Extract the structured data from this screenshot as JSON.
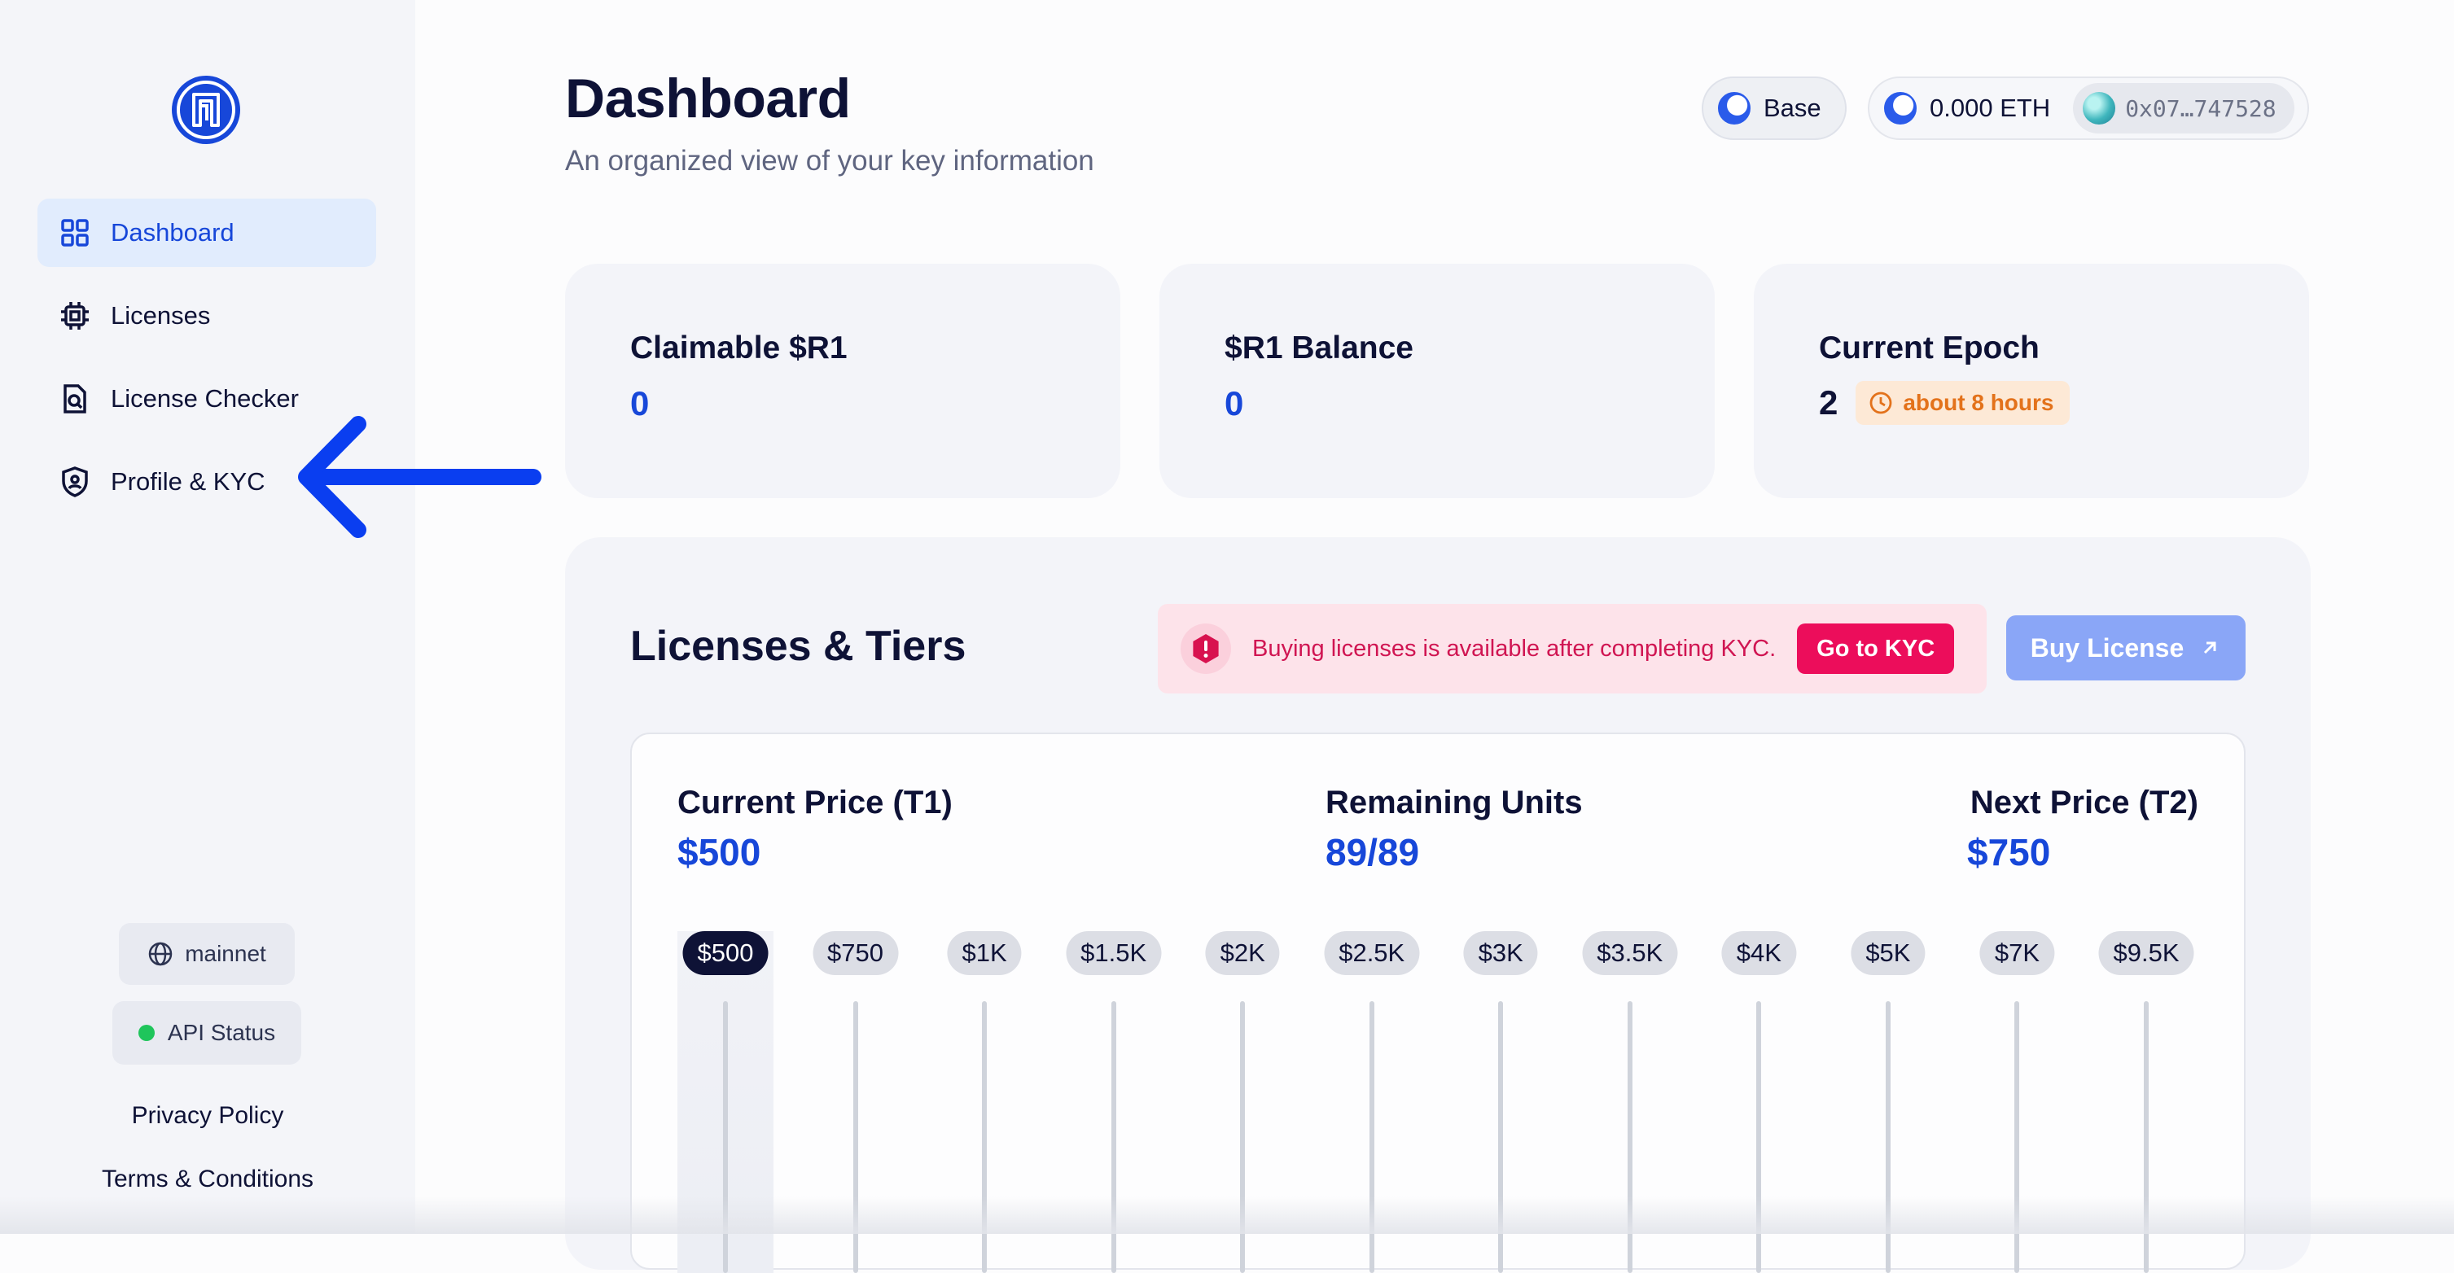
{
  "sidebar": {
    "nav": [
      {
        "label": "Dashboard",
        "icon": "grid-icon",
        "active": true
      },
      {
        "label": "Licenses",
        "icon": "chip-icon",
        "active": false
      },
      {
        "label": "License Checker",
        "icon": "file-search-icon",
        "active": false
      },
      {
        "label": "Profile & KYC",
        "icon": "shield-user-icon",
        "active": false
      }
    ],
    "network": "mainnet",
    "api_status": "API Status",
    "privacy": "Privacy Policy",
    "terms": "Terms & Conditions"
  },
  "header": {
    "title": "Dashboard",
    "subtitle": "An organized view of your key information",
    "chain": "Base",
    "balance": "0.000 ETH",
    "address": "0x07…747528"
  },
  "cards": {
    "claimable": {
      "label": "Claimable $R1",
      "value": "0"
    },
    "balance": {
      "label": "$R1 Balance",
      "value": "0"
    },
    "epoch": {
      "label": "Current Epoch",
      "value": "2",
      "badge": "about 8 hours"
    }
  },
  "licenses": {
    "title": "Licenses & Tiers",
    "alert": "Buying licenses is available after completing KYC.",
    "kyc_button": "Go to KYC",
    "buy_button": "Buy License",
    "current_price_label": "Current Price (T1)",
    "current_price": "$500",
    "remaining_label": "Remaining Units",
    "remaining": "89/89",
    "next_price_label": "Next Price (T2)",
    "next_price": "$750",
    "tiers": [
      "$500",
      "$750",
      "$1K",
      "$1.5K",
      "$2K",
      "$2.5K",
      "$3K",
      "$3.5K",
      "$4K",
      "$5K",
      "$7K",
      "$9.5K"
    ]
  },
  "colors": {
    "accent": "#1747d9",
    "alert": "#ec0d5b",
    "arrow": "#0a3ef0",
    "status_ok": "#1fc55b",
    "epoch_badge": "#e3721b"
  }
}
